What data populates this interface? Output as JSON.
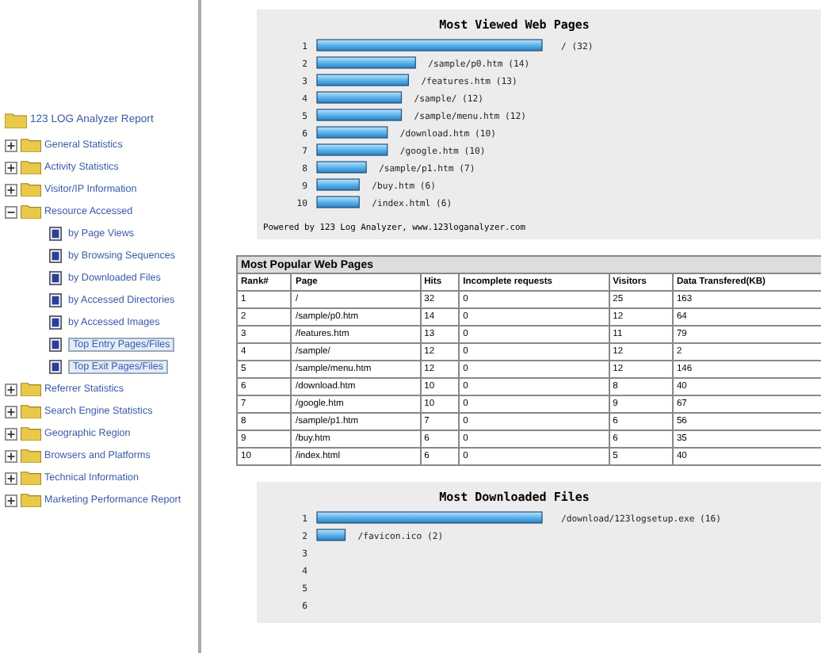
{
  "sidebar": {
    "title": "123 LOG Analyzer Report",
    "items": [
      {
        "label": "General Statistics",
        "expanded": false
      },
      {
        "label": "Activity Statistics",
        "expanded": false
      },
      {
        "label": "Visitor/IP Information",
        "expanded": false
      },
      {
        "label": "Resource Accessed",
        "expanded": true,
        "children": [
          {
            "label": "by Page Views",
            "selected": false
          },
          {
            "label": "by Browsing Sequences",
            "selected": false
          },
          {
            "label": "by Downloaded Files",
            "selected": false
          },
          {
            "label": "by Accessed Directories",
            "selected": false
          },
          {
            "label": "by Accessed Images",
            "selected": false
          },
          {
            "label": "Top Entry Pages/Files",
            "selected": true
          },
          {
            "label": "Top Exit Pages/Files",
            "selected": true
          }
        ]
      },
      {
        "label": "Referrer Statistics",
        "expanded": false
      },
      {
        "label": "Search Engine Statistics",
        "expanded": false
      },
      {
        "label": "Geographic Region",
        "expanded": false
      },
      {
        "label": "Browsers and Platforms",
        "expanded": false
      },
      {
        "label": "Technical Information",
        "expanded": false
      },
      {
        "label": "Marketing Performance Report",
        "expanded": false
      }
    ]
  },
  "viewed_chart": {
    "footer": "Powered by 123 Log Analyzer, www.123loganalyzer.com",
    "chart_data": {
      "type": "bar",
      "orientation": "horizontal",
      "title": "Most Viewed Web Pages",
      "categories": [
        "1",
        "2",
        "3",
        "4",
        "5",
        "6",
        "7",
        "8",
        "9",
        "10"
      ],
      "values": [
        32,
        14,
        13,
        12,
        12,
        10,
        10,
        7,
        6,
        6
      ],
      "value_labels": [
        "/ (32)",
        "/sample/p0.htm (14)",
        "/features.htm (13)",
        "/sample/ (12)",
        "/sample/menu.htm (12)",
        "/download.htm (10)",
        "/google.htm (10)",
        "/sample/p1.htm (7)",
        "/buy.htm (6)",
        "/index.html (6)"
      ]
    }
  },
  "table": {
    "title": "Most Popular Web Pages",
    "columns": [
      "Rank#",
      "Page",
      "Hits",
      "Incomplete requests",
      "Visitors",
      "Data Transfered(KB)"
    ],
    "rows": [
      [
        "1",
        "/",
        "32",
        "0",
        "25",
        "163"
      ],
      [
        "2",
        "/sample/p0.htm",
        "14",
        "0",
        "12",
        "64"
      ],
      [
        "3",
        "/features.htm",
        "13",
        "0",
        "11",
        "79"
      ],
      [
        "4",
        "/sample/",
        "12",
        "0",
        "12",
        "2"
      ],
      [
        "5",
        "/sample/menu.htm",
        "12",
        "0",
        "12",
        "146"
      ],
      [
        "6",
        "/download.htm",
        "10",
        "0",
        "8",
        "40"
      ],
      [
        "7",
        "/google.htm",
        "10",
        "0",
        "9",
        "67"
      ],
      [
        "8",
        "/sample/p1.htm",
        "7",
        "0",
        "6",
        "56"
      ],
      [
        "9",
        "/buy.htm",
        "6",
        "0",
        "6",
        "35"
      ],
      [
        "10",
        "/index.html",
        "6",
        "0",
        "5",
        "40"
      ]
    ]
  },
  "downloaded_chart": {
    "chart_data": {
      "type": "bar",
      "orientation": "horizontal",
      "title": "Most Downloaded Files",
      "categories": [
        "1",
        "2",
        "3",
        "4",
        "5",
        "6"
      ],
      "values": [
        16,
        2,
        null,
        null,
        null,
        null
      ],
      "value_labels": [
        "/download/123logsetup.exe (16)",
        "/favicon.ico (2)",
        null,
        null,
        null,
        null
      ]
    }
  }
}
